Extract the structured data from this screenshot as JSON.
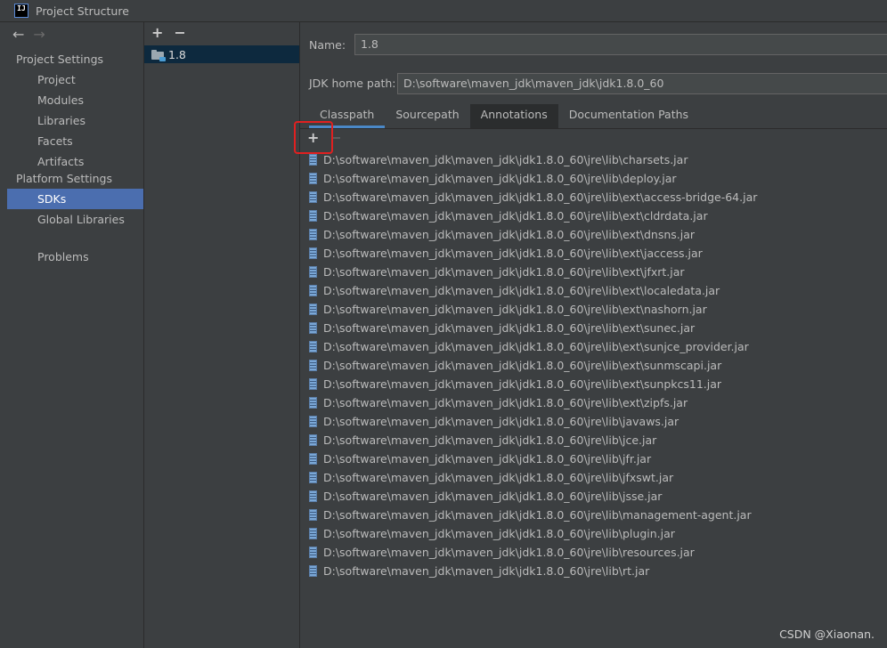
{
  "window": {
    "title": "Project Structure",
    "logo_text": "IJ"
  },
  "nav": {
    "back": "←",
    "forward": "→",
    "sections": [
      {
        "label": "Project Settings",
        "items": [
          "Project",
          "Modules",
          "Libraries",
          "Facets",
          "Artifacts"
        ]
      },
      {
        "label": "Platform Settings",
        "items": [
          "SDKs",
          "Global Libraries"
        ]
      }
    ],
    "problems": "Problems",
    "selected": "SDKs"
  },
  "sdk_panel": {
    "add": "+",
    "remove": "−",
    "items": [
      "1.8"
    ]
  },
  "main": {
    "name_label": "Name:",
    "name_value": "1.8",
    "home_label": "JDK home path:",
    "home_value": "D:\\software\\maven_jdk\\maven_jdk\\jdk1.8.0_60",
    "tabs": [
      "Classpath",
      "Sourcepath",
      "Annotations",
      "Documentation Paths"
    ],
    "active_tab": "Classpath",
    "list_add": "+",
    "list_remove": "−",
    "paths": [
      "D:\\software\\maven_jdk\\maven_jdk\\jdk1.8.0_60\\jre\\lib\\charsets.jar",
      "D:\\software\\maven_jdk\\maven_jdk\\jdk1.8.0_60\\jre\\lib\\deploy.jar",
      "D:\\software\\maven_jdk\\maven_jdk\\jdk1.8.0_60\\jre\\lib\\ext\\access-bridge-64.jar",
      "D:\\software\\maven_jdk\\maven_jdk\\jdk1.8.0_60\\jre\\lib\\ext\\cldrdata.jar",
      "D:\\software\\maven_jdk\\maven_jdk\\jdk1.8.0_60\\jre\\lib\\ext\\dnsns.jar",
      "D:\\software\\maven_jdk\\maven_jdk\\jdk1.8.0_60\\jre\\lib\\ext\\jaccess.jar",
      "D:\\software\\maven_jdk\\maven_jdk\\jdk1.8.0_60\\jre\\lib\\ext\\jfxrt.jar",
      "D:\\software\\maven_jdk\\maven_jdk\\jdk1.8.0_60\\jre\\lib\\ext\\localedata.jar",
      "D:\\software\\maven_jdk\\maven_jdk\\jdk1.8.0_60\\jre\\lib\\ext\\nashorn.jar",
      "D:\\software\\maven_jdk\\maven_jdk\\jdk1.8.0_60\\jre\\lib\\ext\\sunec.jar",
      "D:\\software\\maven_jdk\\maven_jdk\\jdk1.8.0_60\\jre\\lib\\ext\\sunjce_provider.jar",
      "D:\\software\\maven_jdk\\maven_jdk\\jdk1.8.0_60\\jre\\lib\\ext\\sunmscapi.jar",
      "D:\\software\\maven_jdk\\maven_jdk\\jdk1.8.0_60\\jre\\lib\\ext\\sunpkcs11.jar",
      "D:\\software\\maven_jdk\\maven_jdk\\jdk1.8.0_60\\jre\\lib\\ext\\zipfs.jar",
      "D:\\software\\maven_jdk\\maven_jdk\\jdk1.8.0_60\\jre\\lib\\javaws.jar",
      "D:\\software\\maven_jdk\\maven_jdk\\jdk1.8.0_60\\jre\\lib\\jce.jar",
      "D:\\software\\maven_jdk\\maven_jdk\\jdk1.8.0_60\\jre\\lib\\jfr.jar",
      "D:\\software\\maven_jdk\\maven_jdk\\jdk1.8.0_60\\jre\\lib\\jfxswt.jar",
      "D:\\software\\maven_jdk\\maven_jdk\\jdk1.8.0_60\\jre\\lib\\jsse.jar",
      "D:\\software\\maven_jdk\\maven_jdk\\jdk1.8.0_60\\jre\\lib\\management-agent.jar",
      "D:\\software\\maven_jdk\\maven_jdk\\jdk1.8.0_60\\jre\\lib\\plugin.jar",
      "D:\\software\\maven_jdk\\maven_jdk\\jdk1.8.0_60\\jre\\lib\\resources.jar",
      "D:\\software\\maven_jdk\\maven_jdk\\jdk1.8.0_60\\jre\\lib\\rt.jar"
    ]
  },
  "watermark": "CSDN @Xiaonan.",
  "colors": {
    "selection": "#4b6eaf",
    "tab_accent": "#4a88c7",
    "highlight": "#e02020"
  }
}
